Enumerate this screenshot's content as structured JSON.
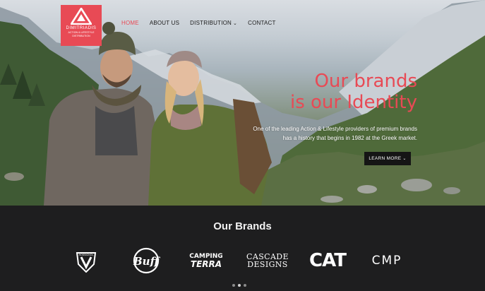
{
  "header": {
    "logo": {
      "name": "DIMITRIADIS",
      "subtitle_line1": "ACTION & LIFESTYLE",
      "subtitle_line2": "DISTRIBUTION"
    },
    "nav": [
      {
        "label": "HOME",
        "active": true
      },
      {
        "label": "ABOUT US",
        "active": false
      },
      {
        "label": "Distribution",
        "active": false,
        "has_dropdown": true
      },
      {
        "label": "CONTACT",
        "active": false
      }
    ]
  },
  "hero": {
    "headline_line1": "Our brands",
    "headline_line2": "is our Identity",
    "description": "One of the leading Action & Lifestyle providers of premium brands has a history that begins in 1982 at the Greek market.",
    "cta_label": "LEARN MORE",
    "cta_icon": "chevron-down-icon"
  },
  "brands_section": {
    "title": "Our Brands",
    "brands": [
      {
        "name": "Rossignol",
        "wordmark": "ROSSIGNOL"
      },
      {
        "name": "Buff",
        "wordmark": "Buff"
      },
      {
        "name": "Camping Terra",
        "wordmark_line1": "CAMPING",
        "wordmark_line2": "TERRA"
      },
      {
        "name": "Cascade Designs",
        "wordmark_line1": "CASCADE",
        "wordmark_line2": "DESIGNS"
      },
      {
        "name": "CAT",
        "wordmark": "CAT"
      },
      {
        "name": "CMP",
        "wordmark": "CMP"
      }
    ],
    "carousel": {
      "slides": 3,
      "active": 2
    }
  },
  "colors": {
    "accent": "#e84a55",
    "footer_bg": "#1e1e1f",
    "button_bg": "#151515"
  }
}
